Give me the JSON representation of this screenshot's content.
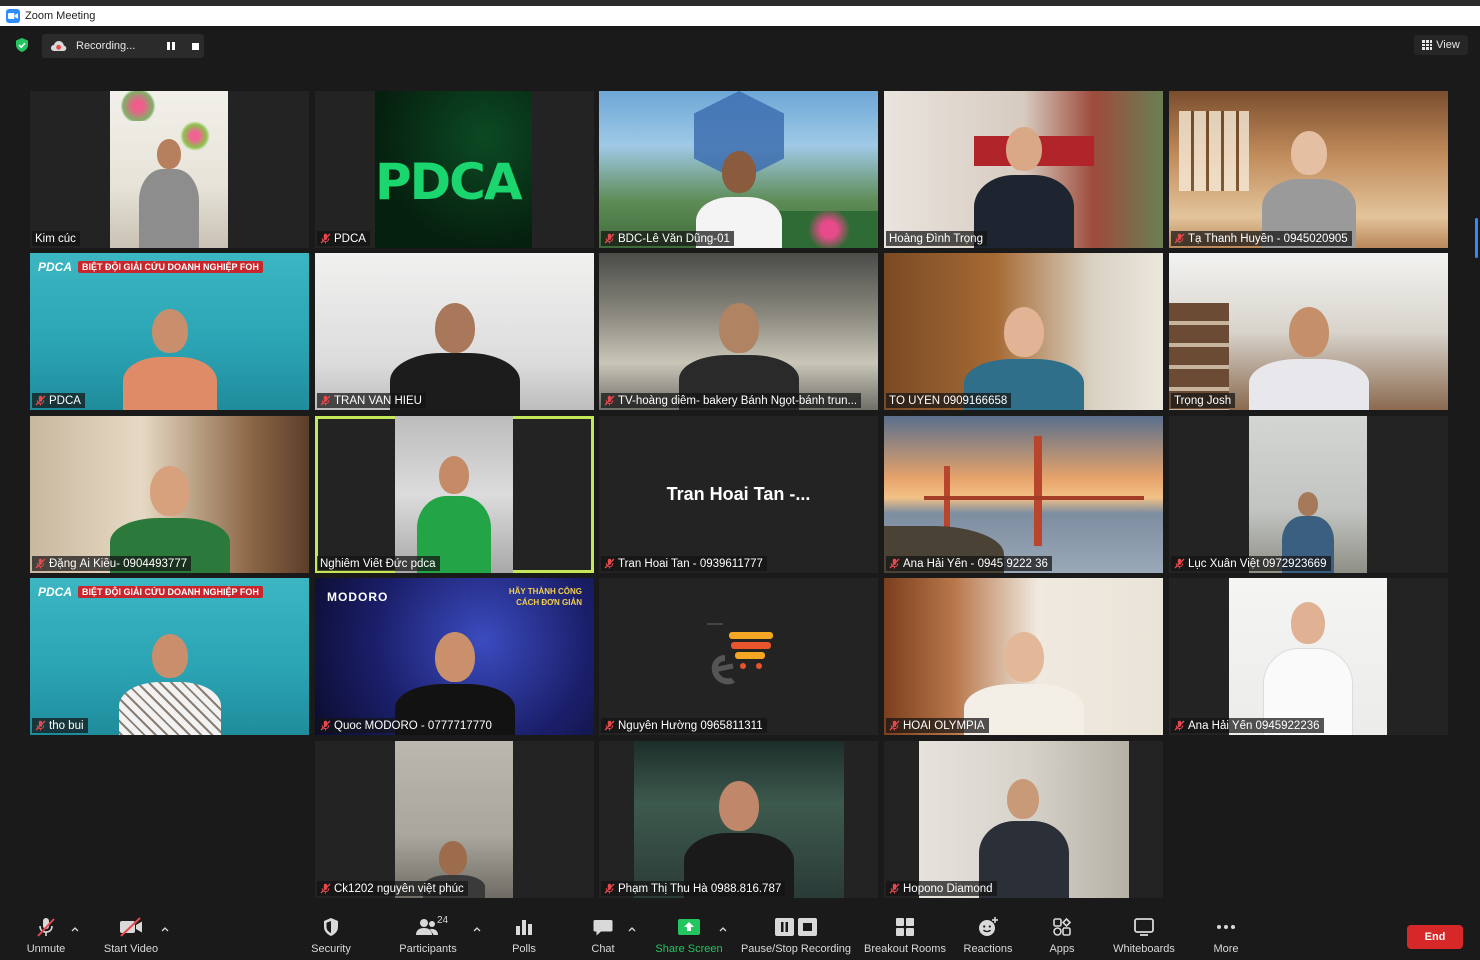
{
  "window": {
    "title": "Zoom Meeting"
  },
  "recording": {
    "label": "Recording..."
  },
  "view_button": {
    "label": "View"
  },
  "participants": [
    {
      "name": "Kim cúc",
      "muted": false
    },
    {
      "name": "PDCA",
      "muted": true
    },
    {
      "name": "BDC-Lê Văn Dũng-01",
      "muted": true
    },
    {
      "name": "Hoàng Đình Trọng",
      "muted": false
    },
    {
      "name": "Tạ Thanh Huyền - 0945020905",
      "muted": true
    },
    {
      "name": "PDCA",
      "muted": true
    },
    {
      "name": "TRAN VAN HIEU",
      "muted": true
    },
    {
      "name": "TV-hoàng diễm- bakery Bánh Ngọt-bánh trun...",
      "muted": true
    },
    {
      "name": "TÔ UYÊN 0909166658",
      "muted": false
    },
    {
      "name": "Trọng Josh",
      "muted": false
    },
    {
      "name": "Đặng Ái Kiều- 0904493777",
      "muted": true
    },
    {
      "name": "Nghiêm Viết Đức pdca",
      "muted": false
    },
    {
      "name": "Tran Hoai Tan  - 0939611777",
      "muted": true
    },
    {
      "name": "Ana Hải Yến - 0945 9222 36",
      "muted": true
    },
    {
      "name": "Lục Xuân Việt 0972923669",
      "muted": true
    },
    {
      "name": "tho bui",
      "muted": true
    },
    {
      "name": "Quoc MODORO - 0777717770",
      "muted": true
    },
    {
      "name": "Nguyễn Hường 0965811311",
      "muted": true
    },
    {
      "name": "HOÀI OLYMPIA",
      "muted": true
    },
    {
      "name": "Ana Hải Yến 0945922236",
      "muted": true
    },
    {
      "name": "Ck1202 nguyễn việt phúc",
      "muted": true
    },
    {
      "name": "Phạm Thị Thu Hà 0988.816.787",
      "muted": true
    },
    {
      "name": "Hopono Diamond",
      "muted": true
    }
  ],
  "video_off_name": "Tran Hoai Tan  -...",
  "tile_texts": {
    "pdca_logo": "PDCA",
    "banner_logo": "PDCA",
    "banner_text": "BIỆT ĐỘI GIẢI CỨU DOANH NGHIỆP FOH",
    "modoro": "MODORO",
    "slogan_line1": "HÃY THÀNH CÔNG",
    "slogan_line2": "CÁCH ĐƠN GIẢN"
  },
  "toolbar": {
    "unmute": "Unmute",
    "start_video": "Start Video",
    "security": "Security",
    "participants": "Participants",
    "participants_count": "24",
    "polls": "Polls",
    "chat": "Chat",
    "share_screen": "Share Screen",
    "pause_stop_recording": "Pause/Stop Recording",
    "breakout_rooms": "Breakout Rooms",
    "reactions": "Reactions",
    "apps": "Apps",
    "whiteboards": "Whiteboards",
    "more": "More",
    "end": "End"
  },
  "colors": {
    "accent_blue": "#2d8cff",
    "active_speaker": "#c5e85a",
    "share_green": "#22c55e",
    "end_red": "#d62828",
    "muted_red": "#e5484d"
  }
}
